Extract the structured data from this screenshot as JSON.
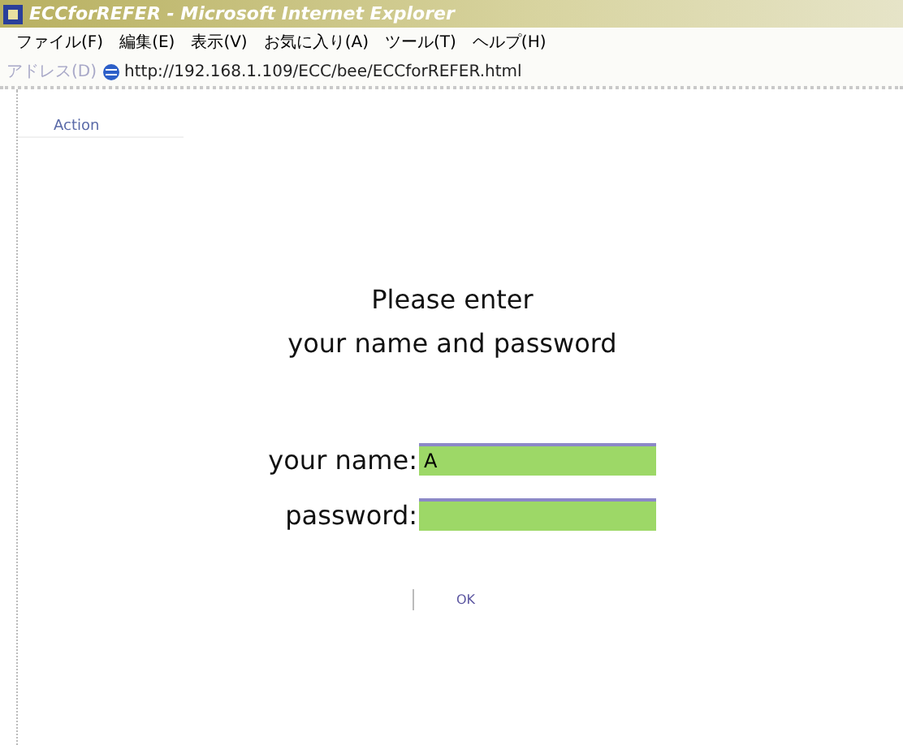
{
  "window": {
    "title": "ECCforREFER - Microsoft Internet Explorer"
  },
  "menu": [
    "ファイル(F)",
    "編集(E)",
    "表示(V)",
    "お気に入り(A)",
    "ツール(T)",
    "ヘルプ(H)"
  ],
  "address": {
    "label": "アドレス(D)",
    "value": "http://192.168.1.109/ECC/bee/ECCforREFER.html"
  },
  "page": {
    "tab": "Action",
    "heading": [
      "Please enter",
      "your name and password"
    ],
    "fields": [
      {
        "label": "your name:",
        "value": "A"
      },
      {
        "label": "password:"
      }
    ],
    "button": "OK"
  }
}
